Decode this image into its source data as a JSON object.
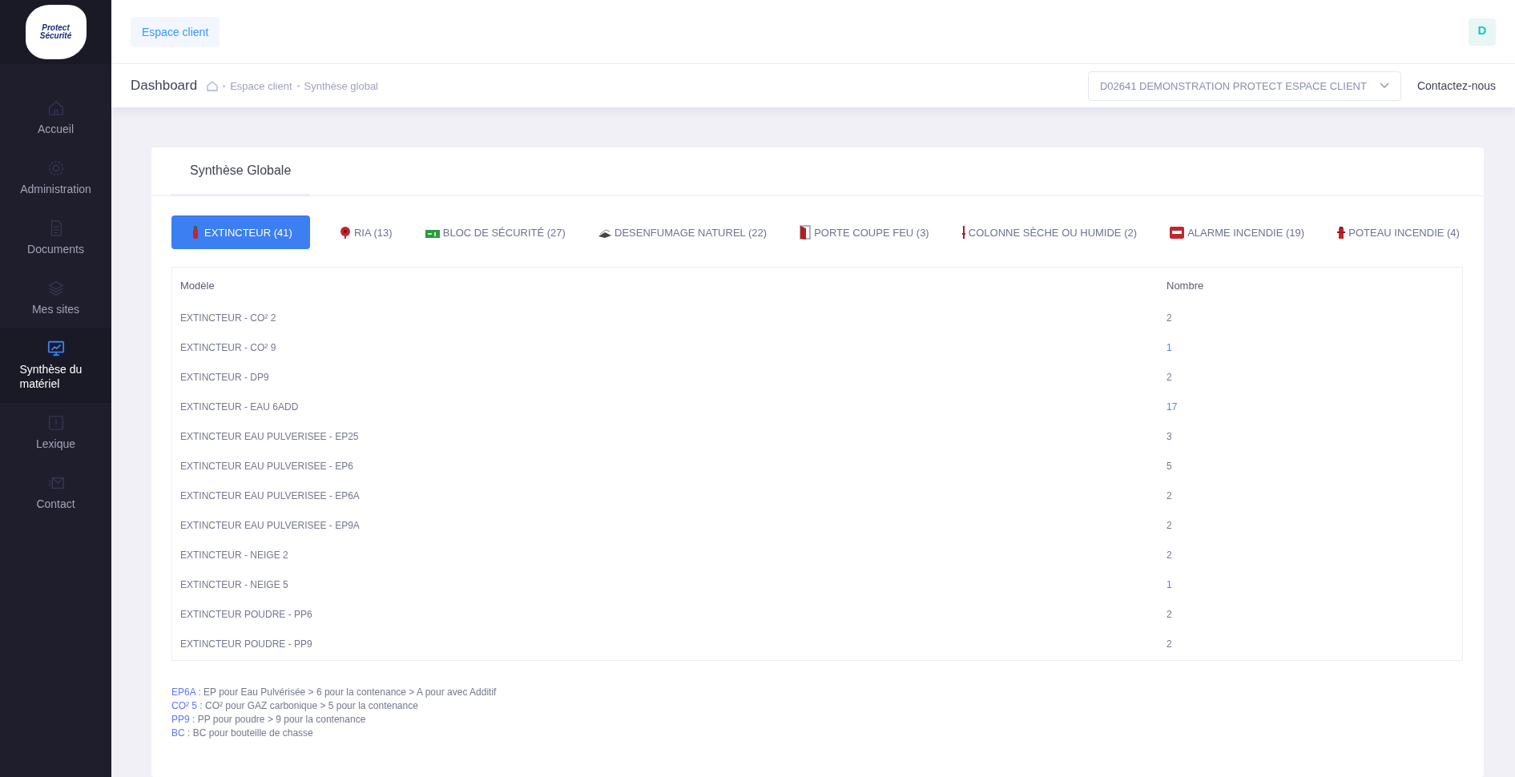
{
  "sidebar": {
    "logo": {
      "line1": "Protect",
      "line2": "Sécurité"
    },
    "items": [
      {
        "label": "Accueil",
        "kind": "home",
        "selected": false
      },
      {
        "label": "Administration",
        "kind": "gear",
        "selected": false
      },
      {
        "label": "Documents",
        "kind": "document",
        "selected": false
      },
      {
        "label": "Mes sites",
        "kind": "layers",
        "selected": false
      },
      {
        "label": "Synthèse du matériel",
        "kind": "chart",
        "selected": true
      },
      {
        "label": "Lexique",
        "kind": "info",
        "selected": false
      },
      {
        "label": "Contact",
        "kind": "mail",
        "selected": false
      }
    ]
  },
  "topbar": {
    "button": "Espace client",
    "avatar": "D"
  },
  "subheader": {
    "title": "Dashboard",
    "breadcrumb": [
      "Espace client",
      "Synthèse global"
    ],
    "client_select": "D02641 DEMONSTRATION PROTECT ESPACE CLIENT",
    "contact": "Contactez-nous"
  },
  "card": {
    "title": "Synthèse Globale",
    "tabs": [
      {
        "label": "EXTINCTEUR (41)",
        "kind": "extinguisher",
        "selected": true
      },
      {
        "label": "RIA (13)",
        "kind": "hose",
        "selected": false
      },
      {
        "label": "BLOC DE SÉCURITÉ (27)",
        "kind": "exit",
        "selected": false
      },
      {
        "label": "DESENFUMAGE NATUREL (22)",
        "kind": "vent",
        "selected": false
      },
      {
        "label": "PORTE COUPE FEU (3)",
        "kind": "door",
        "selected": false
      },
      {
        "label": "COLONNE SÈCHE OU HUMIDE (2)",
        "kind": "column",
        "selected": false
      },
      {
        "label": "ALARME INCENDIE (19)",
        "kind": "alarm",
        "selected": false
      },
      {
        "label": "POTEAU INCENDIE (4)",
        "kind": "hydrant",
        "selected": false
      }
    ],
    "table": {
      "columns": [
        "Modèle",
        "Nombre"
      ],
      "rows": [
        {
          "model": "EXTINCTEUR - CO² 2",
          "count": "2",
          "link": false
        },
        {
          "model": "EXTINCTEUR - CO² 9",
          "count": "1",
          "link": true
        },
        {
          "model": "EXTINCTEUR - DP9",
          "count": "2",
          "link": false
        },
        {
          "model": "EXTINCTEUR - EAU 6ADD",
          "count": "17",
          "link": true
        },
        {
          "model": "EXTINCTEUR EAU PULVERISEE - EP25",
          "count": "3",
          "link": false
        },
        {
          "model": "EXTINCTEUR EAU PULVERISEE - EP6",
          "count": "5",
          "link": false
        },
        {
          "model": "EXTINCTEUR EAU PULVERISEE - EP6A",
          "count": "2",
          "link": false
        },
        {
          "model": "EXTINCTEUR EAU PULVERISEE - EP9A",
          "count": "2",
          "link": false
        },
        {
          "model": "EXTINCTEUR - NEIGE 2",
          "count": "2",
          "link": false
        },
        {
          "model": "EXTINCTEUR - NEIGE 5",
          "count": "1",
          "link": true
        },
        {
          "model": "EXTINCTEUR POUDRE - PP6",
          "count": "2",
          "link": false
        },
        {
          "model": "EXTINCTEUR POUDRE - PP9",
          "count": "2",
          "link": false
        }
      ]
    },
    "legend": [
      {
        "code": "EP6A",
        "text": ": EP pour Eau Pulvérisée > 6 pour la contenance > A pour avec Additif"
      },
      {
        "code": "CO² 5",
        "text": ": CO² pour GAZ carbonique > 5 pour la contenance"
      },
      {
        "code": "PP9",
        "text": ": PP pour poudre > 9 pour la contenance"
      },
      {
        "code": "BC",
        "text": ": BC pour bouteille de chasse"
      }
    ]
  }
}
